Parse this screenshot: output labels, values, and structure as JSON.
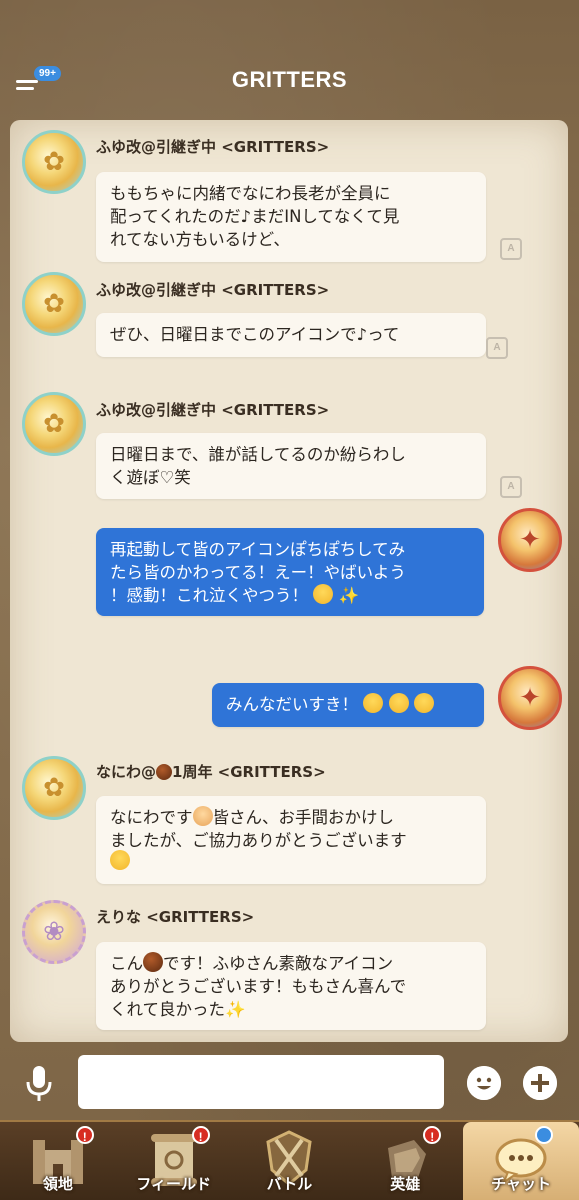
{
  "header": {
    "title": "GRITTERS",
    "menu_badge": "99+"
  },
  "messages": [
    {
      "username": "ふゆ改@引継ぎ中 <GRITTERS>",
      "lines": [
        "ももちゃに内緒でなにわ長老が全員に",
        "配ってくれたのだ♪まだINしてなくて見",
        "れてない方もいるけど、"
      ]
    },
    {
      "username": "ふゆ改@引継ぎ中 <GRITTERS>",
      "lines": [
        "ぜひ、日曜日までこのアイコンで♪って"
      ]
    },
    {
      "username": "ふゆ改@引継ぎ中 <GRITTERS>",
      "lines": [
        "日曜日まで、誰が話してるのか紛らわし",
        "く遊ぼ♡笑"
      ]
    },
    {
      "own": true,
      "lines": [
        "再起動して皆のアイコンぽちぽちしてみ",
        "たら皆のかわってる！えー！やばいよう",
        "！感動！これ泣くやつう！"
      ]
    },
    {
      "own": true,
      "lines": [
        "みんなだいすき！"
      ]
    },
    {
      "username_prefix": "なにわ@",
      "username_suffix": "1周年 <GRITTERS>",
      "lines": [
        "なにわです",
        "皆さん、お手間おかけし",
        "ましたが、ご協力ありがとうございます"
      ]
    },
    {
      "username": "えりな <GRITTERS>",
      "lines": [
        "こん",
        "です！ふゆさん素敵なアイコン",
        "ありがとうございます！ももさん喜んで",
        "くれて良かった"
      ]
    }
  ],
  "input": {
    "placeholder": ""
  },
  "nav": [
    {
      "label": "領地",
      "badge": "!"
    },
    {
      "label": "フィールド",
      "badge": "!"
    },
    {
      "label": "バトル",
      "badge": ""
    },
    {
      "label": "英雄",
      "badge": "!"
    },
    {
      "label": "チャット",
      "badge": "",
      "active": true
    }
  ],
  "icons": {
    "menu": "menu-icon",
    "mic": "microphone-icon",
    "emoji": "smiley-icon",
    "plus": "plus-icon",
    "translate": "translate-icon"
  },
  "colors": {
    "own_bubble": "#2f74d7",
    "other_bubble": "#fbf7ef",
    "badge_red": "#d72d22",
    "badge_blue": "#3b8de0"
  }
}
